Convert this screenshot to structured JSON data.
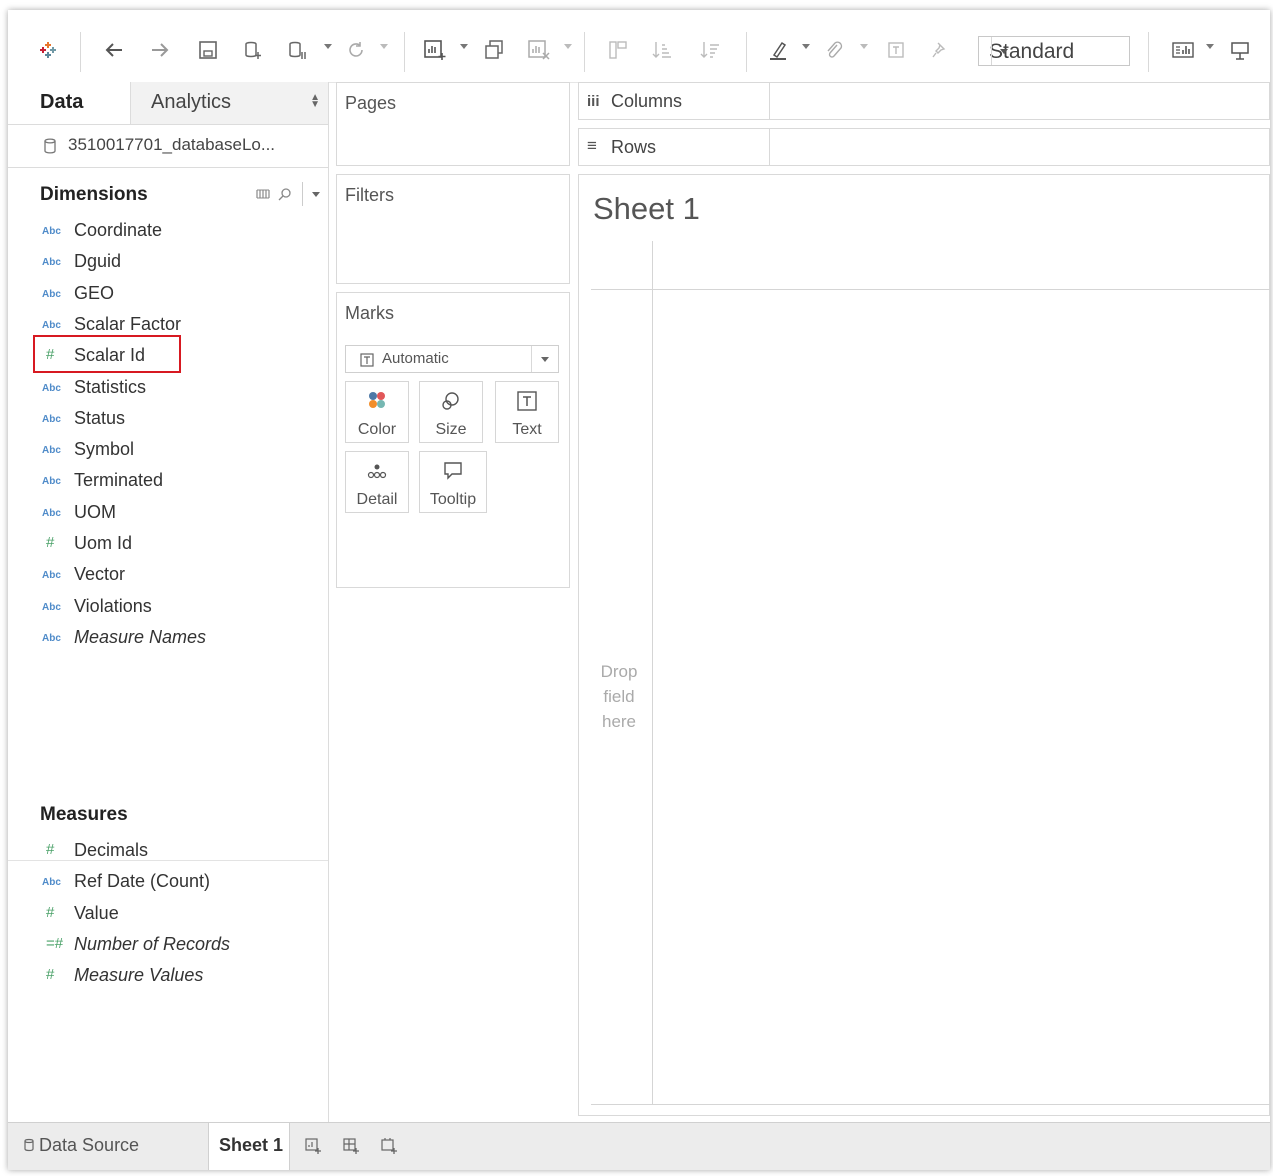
{
  "toolbar": {
    "mark_type_value": "Standard"
  },
  "data_pane": {
    "tab_data": "Data",
    "tab_analytics": "Analytics",
    "data_source": "3510017701_databaseLo...",
    "dimensions_title": "Dimensions",
    "dimensions": [
      {
        "type": "Abc",
        "label": "Coordinate"
      },
      {
        "type": "Abc",
        "label": "Dguid"
      },
      {
        "type": "Abc",
        "label": "GEO"
      },
      {
        "type": "Abc",
        "label": "Scalar Factor"
      },
      {
        "type": "#",
        "label": "Scalar Id"
      },
      {
        "type": "Abc",
        "label": "Statistics"
      },
      {
        "type": "Abc",
        "label": "Status"
      },
      {
        "type": "Abc",
        "label": "Symbol"
      },
      {
        "type": "Abc",
        "label": "Terminated"
      },
      {
        "type": "Abc",
        "label": "UOM"
      },
      {
        "type": "#",
        "label": "Uom Id"
      },
      {
        "type": "Abc",
        "label": "Vector"
      },
      {
        "type": "Abc",
        "label": "Violations"
      },
      {
        "type": "Abc",
        "label": "Measure Names"
      }
    ],
    "measures_title": "Measures",
    "measures": [
      {
        "type": "#",
        "label": "Decimals"
      },
      {
        "type": "Abc",
        "label": "Ref Date (Count)"
      },
      {
        "type": "#",
        "label": "Value"
      },
      {
        "type": "=#",
        "label": "Number of Records"
      },
      {
        "type": "#",
        "label": "Measure Values"
      }
    ]
  },
  "shelves": {
    "pages": "Pages",
    "filters": "Filters",
    "marks": "Marks",
    "marks_type": "Automatic",
    "mark_buttons": [
      "Color",
      "Size",
      "Text",
      "Detail",
      "Tooltip"
    ],
    "columns_icon": "iii",
    "columns": "Columns",
    "rows_icon": "≡",
    "rows": "Rows"
  },
  "view": {
    "sheet_title": "Sheet 1",
    "drop_line1": "Drop",
    "drop_line2": "field",
    "drop_line3": "here"
  },
  "bottom_tabs": {
    "data_source": "Data Source",
    "sheet": "Sheet 1"
  },
  "colors": {
    "highlight": "#d71921",
    "abc_type": "#4f8bc9",
    "number_type": "#4aa168"
  }
}
